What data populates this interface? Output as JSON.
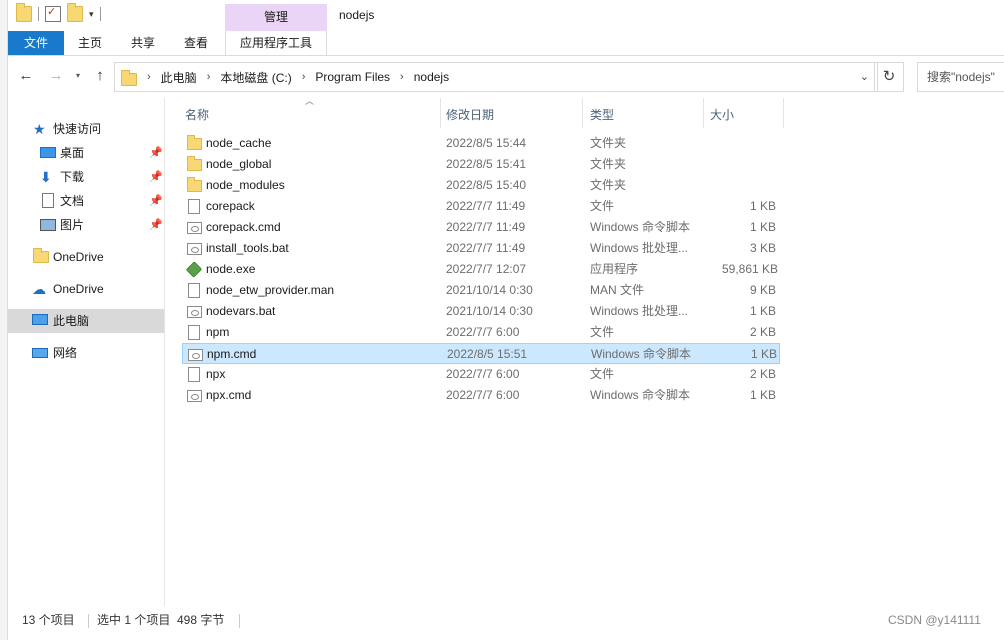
{
  "title_bar": {
    "manage_label": "管理",
    "window_title": "nodejs"
  },
  "ribbon": {
    "tabs": [
      "文件",
      "主页",
      "共享",
      "查看",
      "应用程序工具"
    ]
  },
  "address": {
    "crumbs": [
      "此电脑",
      "本地磁盘 (C:)",
      "Program Files",
      "nodejs"
    ],
    "search_placeholder": "搜索\"nodejs\""
  },
  "navpane": {
    "items": [
      {
        "label": "快速访问",
        "icon": "star-icon",
        "pinned": false
      },
      {
        "label": "桌面",
        "icon": "desktop-icon",
        "pinned": true
      },
      {
        "label": "下载",
        "icon": "download-icon",
        "pinned": true
      },
      {
        "label": "文档",
        "icon": "document-icon",
        "pinned": true
      },
      {
        "label": "图片",
        "icon": "pictures-icon",
        "pinned": true
      },
      {
        "label": "OneDrive",
        "icon": "folder-icon",
        "pinned": false
      },
      {
        "label": "OneDrive",
        "icon": "cloud-icon",
        "pinned": false
      },
      {
        "label": "此电脑",
        "icon": "this-pc-icon",
        "pinned": false,
        "selected": true
      },
      {
        "label": "网络",
        "icon": "network-icon",
        "pinned": false
      }
    ]
  },
  "filelist": {
    "columns": [
      "名称",
      "修改日期",
      "类型",
      "大小"
    ],
    "rows": [
      {
        "name": "node_cache",
        "date": "2022/8/5 15:44",
        "type": "文件夹",
        "size": "",
        "icon": "folder"
      },
      {
        "name": "node_global",
        "date": "2022/8/5 15:41",
        "type": "文件夹",
        "size": "",
        "icon": "folder"
      },
      {
        "name": "node_modules",
        "date": "2022/8/5 15:40",
        "type": "文件夹",
        "size": "",
        "icon": "folder"
      },
      {
        "name": "corepack",
        "date": "2022/7/7 11:49",
        "type": "文件",
        "size": "1 KB",
        "icon": "file"
      },
      {
        "name": "corepack.cmd",
        "date": "2022/7/7 11:49",
        "type": "Windows 命令脚本",
        "size": "1 KB",
        "icon": "cmd"
      },
      {
        "name": "install_tools.bat",
        "date": "2022/7/7 11:49",
        "type": "Windows 批处理...",
        "size": "3 KB",
        "icon": "cmd"
      },
      {
        "name": "node.exe",
        "date": "2022/7/7 12:07",
        "type": "应用程序",
        "size": "59,861 KB",
        "icon": "exe"
      },
      {
        "name": "node_etw_provider.man",
        "date": "2021/10/14 0:30",
        "type": "MAN 文件",
        "size": "9 KB",
        "icon": "file"
      },
      {
        "name": "nodevars.bat",
        "date": "2021/10/14 0:30",
        "type": "Windows 批处理...",
        "size": "1 KB",
        "icon": "cmd"
      },
      {
        "name": "npm",
        "date": "2022/7/7 6:00",
        "type": "文件",
        "size": "2 KB",
        "icon": "file"
      },
      {
        "name": "npm.cmd",
        "date": "2022/8/5 15:51",
        "type": "Windows 命令脚本",
        "size": "1 KB",
        "icon": "cmd",
        "selected": true
      },
      {
        "name": "npx",
        "date": "2022/7/7 6:00",
        "type": "文件",
        "size": "2 KB",
        "icon": "file"
      },
      {
        "name": "npx.cmd",
        "date": "2022/7/7 6:00",
        "type": "Windows 命令脚本",
        "size": "1 KB",
        "icon": "cmd"
      }
    ]
  },
  "statusbar": {
    "count": "13 个项目",
    "selection": "选中 1 个项目  498 字节"
  },
  "watermark": "CSDN @y141111"
}
